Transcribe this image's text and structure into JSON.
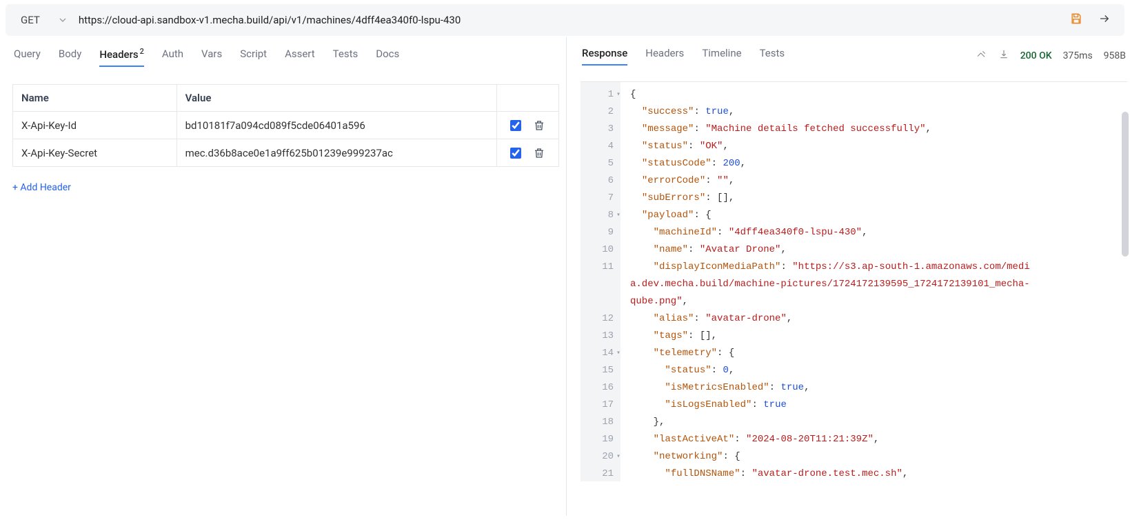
{
  "request": {
    "method": "GET",
    "url": "https://cloud-api.sandbox-v1.mecha.build/api/v1/machines/4dff4ea340f0-lspu-430"
  },
  "left_tabs": {
    "query": "Query",
    "body": "Body",
    "headers_label": "Headers",
    "headers_count": "2",
    "auth": "Auth",
    "vars": "Vars",
    "script": "Script",
    "assert": "Assert",
    "tests": "Tests",
    "docs": "Docs"
  },
  "headers_table": {
    "name_col": "Name",
    "value_col": "Value",
    "rows": [
      {
        "name": "X-Api-Key-Id",
        "value": "bd10181f7a094cd089f5cde06401a596"
      },
      {
        "name": "X-Api-Key-Secret",
        "value": "mec.d36b8ace0e1a9ff625b01239e999237ac"
      }
    ],
    "add_label": "+ Add Header"
  },
  "right_tabs": {
    "response": "Response",
    "headers": "Headers",
    "timeline": "Timeline",
    "tests": "Tests"
  },
  "response_meta": {
    "status": "200 OK",
    "time": "375ms",
    "size": "958B"
  },
  "response_body": {
    "success": true,
    "message": "Machine details fetched successfully",
    "status": "OK",
    "statusCode": 200,
    "errorCode": "",
    "subErrors": [],
    "payload": {
      "machineId": "4dff4ea340f0-lspu-430",
      "name": "Avatar Drone",
      "displayIconMediaPath": "https://s3.ap-south-1.amazonaws.com/media.dev.mecha.build/machine-pictures/1724172139595_1724172139101_mecha-qube.png",
      "alias": "avatar-drone",
      "tags": [],
      "telemetry": {
        "status": 0,
        "isMetricsEnabled": true,
        "isLogsEnabled": true
      },
      "lastActiveAt": "2024-08-20T11:21:39Z",
      "networking": {
        "fullDNSName": "avatar-drone.test.mec.sh"
      }
    }
  },
  "code_lines": [
    {
      "n": "1",
      "fold": true,
      "indent": 0,
      "raw": "{"
    },
    {
      "n": "2",
      "indent": 1,
      "key": "success",
      "val": "true",
      "vclass": "n",
      "comma": true
    },
    {
      "n": "3",
      "indent": 1,
      "key": "message",
      "val": "\"Machine details fetched successfully\"",
      "vclass": "s",
      "comma": true
    },
    {
      "n": "4",
      "indent": 1,
      "key": "status",
      "val": "\"OK\"",
      "vclass": "s",
      "comma": true
    },
    {
      "n": "5",
      "indent": 1,
      "key": "statusCode",
      "val": "200",
      "vclass": "n",
      "comma": true
    },
    {
      "n": "6",
      "indent": 1,
      "key": "errorCode",
      "val": "\"\"",
      "vclass": "s",
      "comma": true
    },
    {
      "n": "7",
      "indent": 1,
      "key": "subErrors",
      "val": "[]",
      "vclass": "p",
      "comma": true
    },
    {
      "n": "8",
      "fold": true,
      "indent": 1,
      "key": "payload",
      "val": "{",
      "vclass": "p"
    },
    {
      "n": "9",
      "indent": 2,
      "key": "machineId",
      "val": "\"4dff4ea340f0-lspu-430\"",
      "vclass": "s",
      "comma": true
    },
    {
      "n": "10",
      "indent": 2,
      "key": "name",
      "val": "\"Avatar Drone\"",
      "vclass": "s",
      "comma": true
    },
    {
      "n": "11",
      "indent": 2,
      "key": "displayIconMediaPath",
      "wrap": [
        "\"https://s3.ap-south-1.amazonaws.com/medi",
        "a.dev.mecha.build/machine-pictures/1724172139595_1724172139101_mecha-",
        "qube.png\""
      ],
      "vclass": "s",
      "comma": true
    },
    {
      "n": "12",
      "indent": 2,
      "key": "alias",
      "val": "\"avatar-drone\"",
      "vclass": "s",
      "comma": true
    },
    {
      "n": "13",
      "indent": 2,
      "key": "tags",
      "val": "[]",
      "vclass": "p",
      "comma": true
    },
    {
      "n": "14",
      "fold": true,
      "indent": 2,
      "key": "telemetry",
      "val": "{",
      "vclass": "p"
    },
    {
      "n": "15",
      "indent": 3,
      "key": "status",
      "val": "0",
      "vclass": "n",
      "comma": true
    },
    {
      "n": "16",
      "indent": 3,
      "key": "isMetricsEnabled",
      "val": "true",
      "vclass": "n",
      "comma": true
    },
    {
      "n": "17",
      "indent": 3,
      "key": "isLogsEnabled",
      "val": "true",
      "vclass": "n"
    },
    {
      "n": "18",
      "indent": 2,
      "raw": "},",
      "rclass": "p"
    },
    {
      "n": "19",
      "indent": 2,
      "key": "lastActiveAt",
      "val": "\"2024-08-20T11:21:39Z\"",
      "vclass": "s",
      "comma": true
    },
    {
      "n": "20",
      "fold": true,
      "indent": 2,
      "key": "networking",
      "val": "{",
      "vclass": "p"
    },
    {
      "n": "21",
      "indent": 3,
      "key": "fullDNSName",
      "val": "\"avatar-drone.test.mec.sh\"",
      "vclass": "s",
      "comma": true
    }
  ]
}
